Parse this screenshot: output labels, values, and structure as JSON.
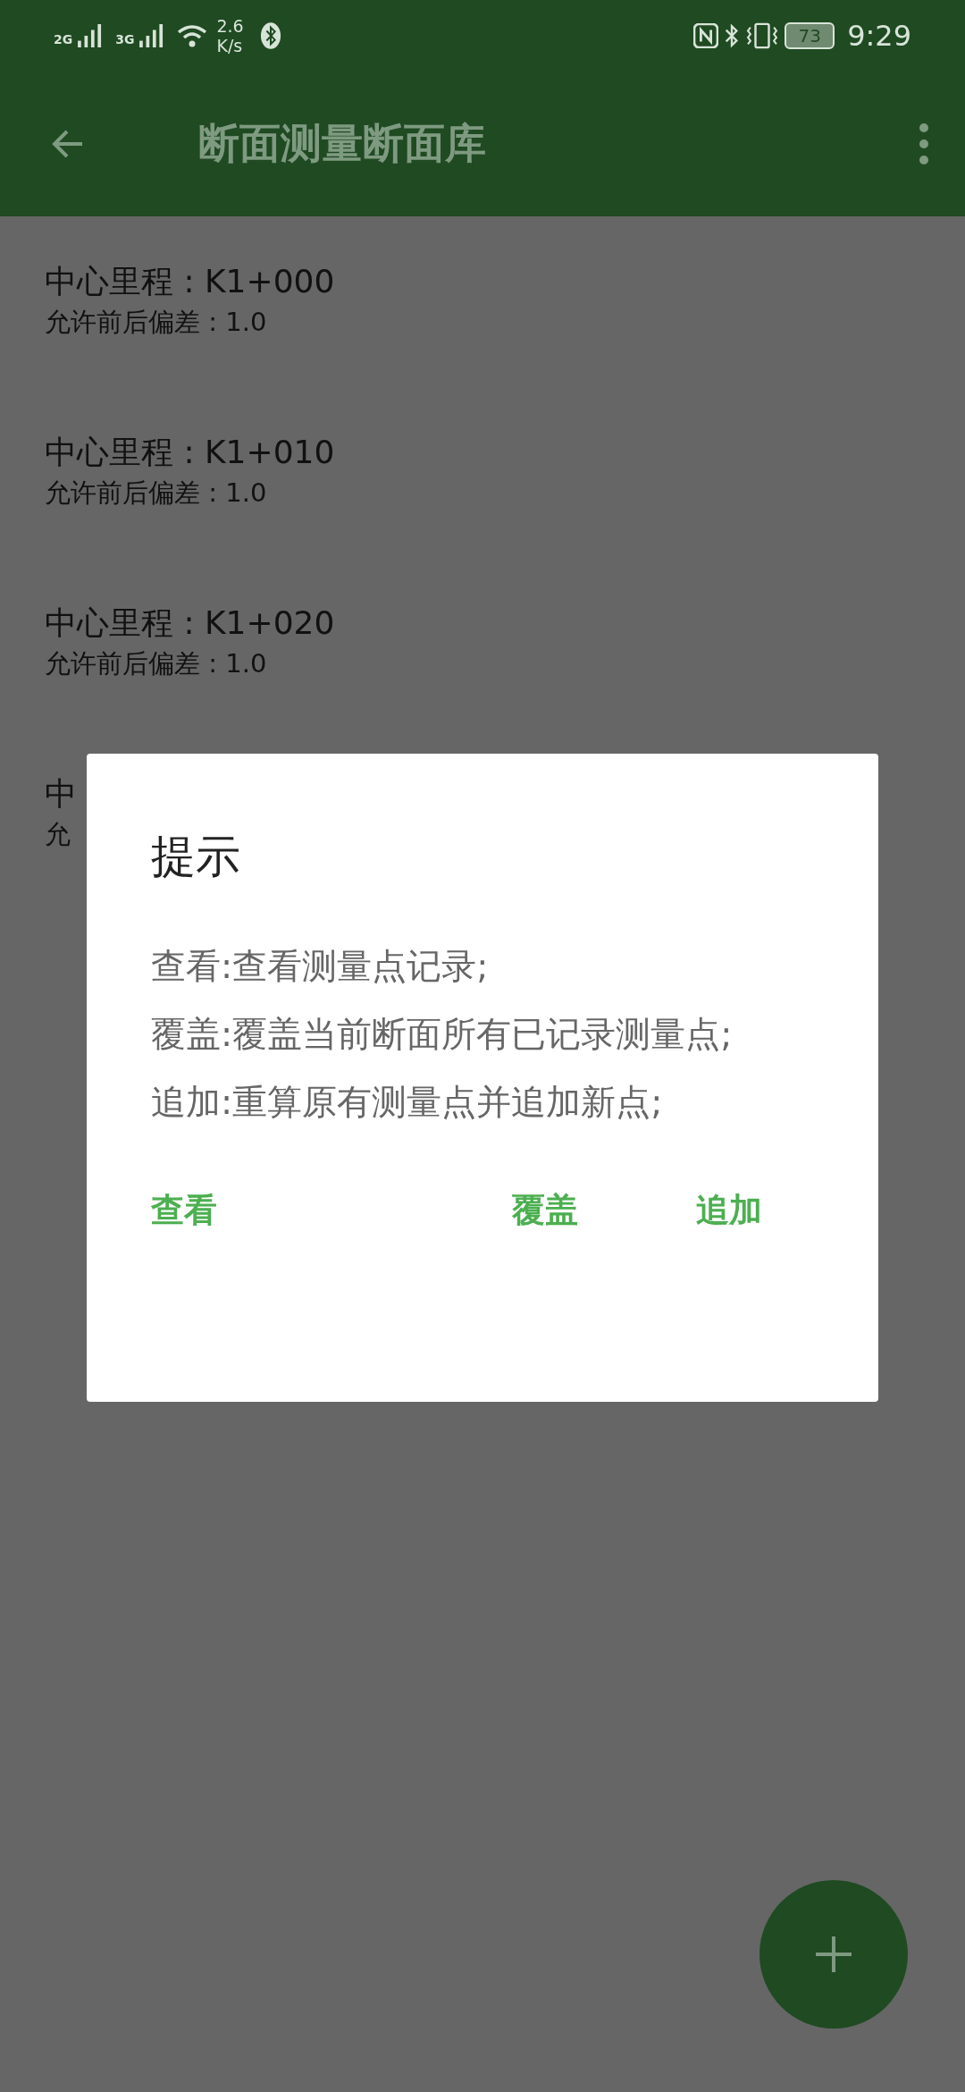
{
  "status_bar": {
    "signal_1": "2G",
    "signal_2": "3G",
    "speed_value": "2.6",
    "speed_unit": "K/s",
    "battery": "73",
    "time": "9:29"
  },
  "app_bar": {
    "title": "断面测量断面库"
  },
  "sections": [
    {
      "mileage": "中心里程 : K1+000",
      "tolerance": "允许前后偏差 : 1.0"
    },
    {
      "mileage": "中心里程 : K1+010",
      "tolerance": "允许前后偏差 : 1.0"
    },
    {
      "mileage": "中心里程 : K1+020",
      "tolerance": "允许前后偏差 : 1.0"
    },
    {
      "mileage": "中",
      "tolerance": "允"
    }
  ],
  "dialog": {
    "title": "提示",
    "lines": [
      "查看:查看测量点记录;",
      "覆盖:覆盖当前断面所有已记录测量点;",
      "追加:重算原有测量点并追加新点;"
    ],
    "buttons": [
      "查看",
      "覆盖",
      "追加"
    ]
  }
}
